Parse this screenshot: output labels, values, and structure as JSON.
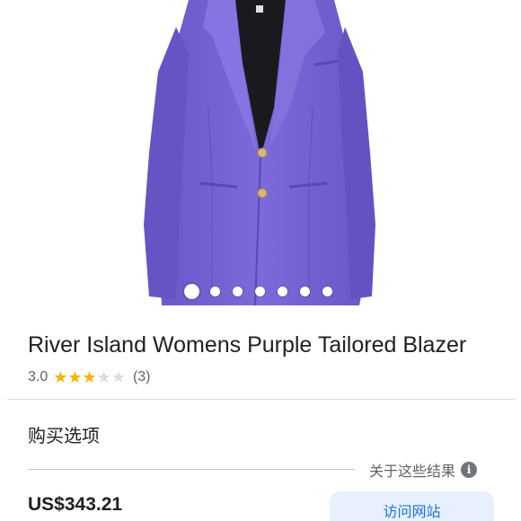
{
  "product": {
    "image_subject": "purple-tailored-blazer",
    "gallery": {
      "count": 7,
      "active_index": 0
    },
    "title": "River Island Womens Purple Tailored Blazer",
    "rating": {
      "value": "3.0",
      "stars_filled": 3,
      "stars_total": 5,
      "reviews": "(3)"
    }
  },
  "offers": {
    "section_title": "购买选项",
    "about_results": "关于这些结果",
    "info_icon": "info-icon",
    "price": "US$343.21",
    "visit_button": "访问网站"
  },
  "colors": {
    "blazer": "#7a67d6",
    "star_on": "#f4b400",
    "star_off": "#dadce0",
    "button_bg": "#e8f0fe",
    "button_text": "#1a73e8"
  }
}
